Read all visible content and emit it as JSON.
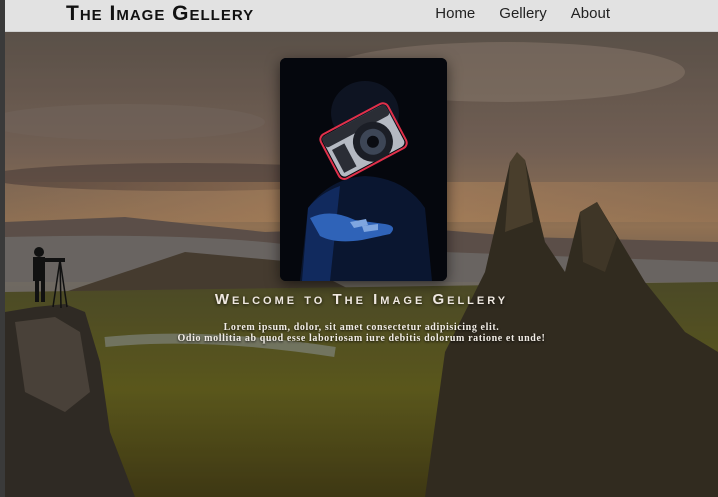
{
  "navbar": {
    "brand": "The Image Gellery",
    "links": [
      {
        "label": "Home"
      },
      {
        "label": "Gellery"
      },
      {
        "label": "About"
      }
    ]
  },
  "hero": {
    "welcome": "Welcome to The Image Gellery",
    "description_line1": "Lorem ipsum, dolor, sit amet consectetur adipisicing elit.",
    "description_line2": "Odio mollitia ab quod esse laboriosam iure debitis dolorum ratione et unde!"
  },
  "colors": {
    "navbar_bg": "#e2e2e2",
    "brand_text": "#111111",
    "hero_text": "#efe8e0"
  }
}
